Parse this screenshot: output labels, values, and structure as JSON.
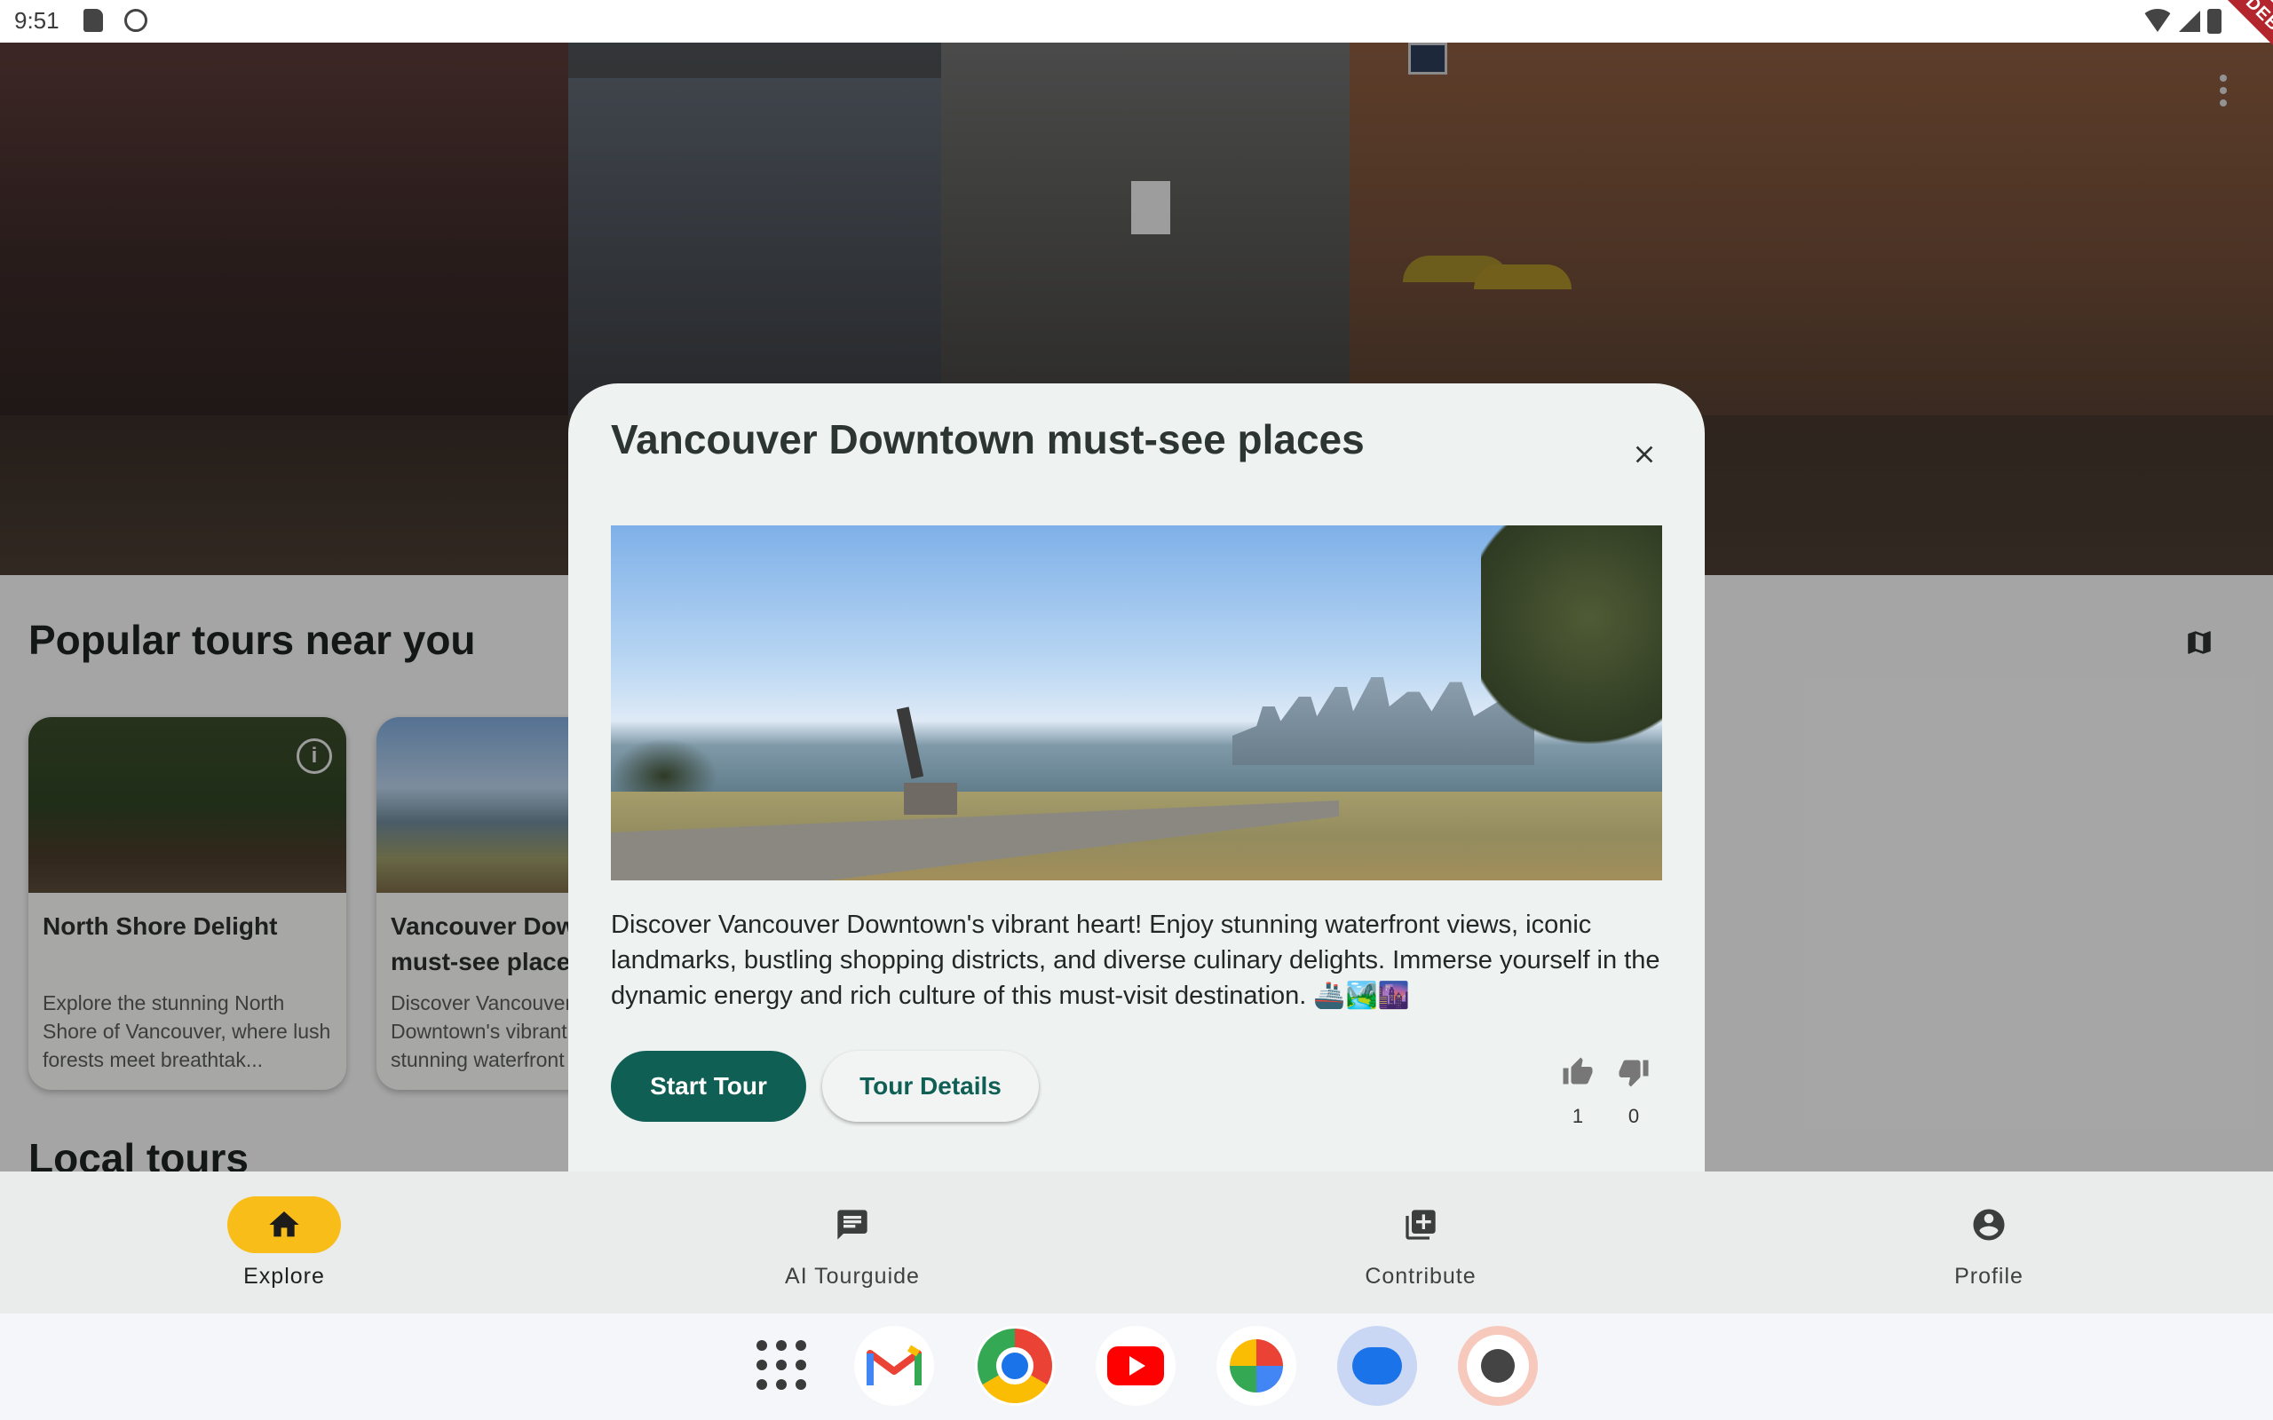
{
  "status_bar": {
    "time": "9:51",
    "debug_label": "DEBUG"
  },
  "explore": {
    "section_title": "Popular tours near you",
    "local_title": "Local tours",
    "cards": [
      {
        "title": "North Shore Delight",
        "description": "Explore the stunning North Shore of Vancouver, where lush forests meet breathtak..."
      },
      {
        "title": "Vancouver Downtown must-see places",
        "description": "Discover Vancouver Downtown's vibrant heart! Enjoy stunning waterfront views..."
      }
    ]
  },
  "dialog": {
    "title": "Vancouver Downtown must-see places",
    "description": "Discover Vancouver Downtown's vibrant heart! Enjoy stunning waterfront views, iconic landmarks, bustling shopping districts, and diverse culinary delights. Immerse yourself in the dynamic energy and rich culture of this must-visit destination. 🚢🏞️🌆",
    "start_label": "Start Tour",
    "details_label": "Tour Details",
    "likes": "1",
    "dislikes": "0"
  },
  "nav": {
    "items": [
      {
        "label": "Explore",
        "icon": "home-icon",
        "active": true
      },
      {
        "label": "AI Tourguide",
        "icon": "chat-icon",
        "active": false
      },
      {
        "label": "Contribute",
        "icon": "add-box-icon",
        "active": false
      },
      {
        "label": "Profile",
        "icon": "account-icon",
        "active": false
      }
    ]
  },
  "taskbar": {
    "apps": [
      "app-drawer",
      "gmail",
      "chrome",
      "youtube",
      "photos",
      "messages",
      "tour-app"
    ]
  },
  "colors": {
    "primary": "#0f5f55",
    "nav_active": "#f9bd1a",
    "debug": "#b3262d"
  }
}
